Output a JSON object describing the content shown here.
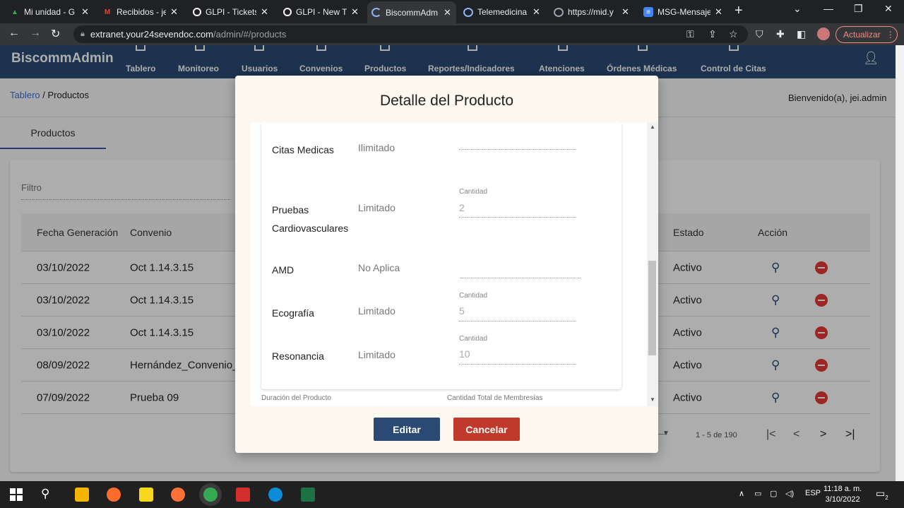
{
  "browser": {
    "tabs": [
      {
        "title": "Mi unidad - G",
        "icon": "drive-icon",
        "color": "#34a853"
      },
      {
        "title": "Recibidos - je",
        "icon": "gmail-icon",
        "color": "#ea4335"
      },
      {
        "title": "GLPI - Tickets",
        "icon": "glpi-icon",
        "color": "#ffffff"
      },
      {
        "title": "GLPI - New Ti",
        "icon": "glpi-icon",
        "color": "#ffffff"
      },
      {
        "title": "BiscommAdm",
        "icon": "loading-icon",
        "color": "#8ab4f8"
      },
      {
        "title": "Telemedicina",
        "icon": "telemed-icon",
        "color": "#8ab4f8"
      },
      {
        "title": "https://mid.y",
        "icon": "globe-icon",
        "color": "#9aa0a6"
      },
      {
        "title": "MSG-Mensaje",
        "icon": "docs-icon",
        "color": "#4285f4"
      }
    ],
    "url_host": "extranet.your24sevendoc.com",
    "url_path": "/admin/#/products",
    "update_label": "Actualizar"
  },
  "app": {
    "brand": "BiscommAdmin",
    "nav": [
      "Tablero",
      "Monitoreo",
      "Usuarios",
      "Convenios",
      "Productos",
      "Reportes/Indicadores",
      "Atenciones",
      "Órdenes Médicas",
      "Control de Citas"
    ],
    "breadcrumb_link": "Tablero",
    "breadcrumb_sep": " / ",
    "breadcrumb_current": "Productos",
    "welcome": "Bienvenido(a), jei.admin",
    "subtab": "Productos",
    "filter_label": "Filtro",
    "columns": {
      "fecha": "Fecha Generación",
      "convenio": "Convenio",
      "estado": "Estado",
      "accion": "Acción"
    },
    "rows": [
      {
        "fecha": "03/10/2022",
        "convenio": "Oct 1.14.3.15",
        "estado": "Activo"
      },
      {
        "fecha": "03/10/2022",
        "convenio": "Oct 1.14.3.15",
        "estado": "Activo"
      },
      {
        "fecha": "03/10/2022",
        "convenio": "Oct 1.14.3.15",
        "estado": "Activo"
      },
      {
        "fecha": "08/09/2022",
        "convenio": "Hernández_Convenio_",
        "estado": "Activo"
      },
      {
        "fecha": "07/09/2022",
        "convenio": "Prueba 09",
        "estado": "Activo"
      }
    ],
    "pager_range": "1 - 5 de 190"
  },
  "modal": {
    "title": "Detalle del Producto",
    "services": [
      {
        "name": "Citas Medicas",
        "status": "Ilimitado",
        "qty_label": "",
        "qty": ""
      },
      {
        "name": "Pruebas Cardiovasculares",
        "status": "Limitado",
        "qty_label": "Cantidad",
        "qty": "2"
      },
      {
        "name": "AMD",
        "status": "No Aplica",
        "qty_label": "",
        "qty": ""
      },
      {
        "name": "Ecografía",
        "status": "Limitado",
        "qty_label": "Cantidad",
        "qty": "5"
      },
      {
        "name": "Resonancia",
        "status": "Limitado",
        "qty_label": "Cantidad",
        "qty": "10"
      }
    ],
    "footer_duration_label": "Duración del Producto",
    "footer_total_label": "Cantidad Total de Membresías",
    "edit_label": "Editar",
    "cancel_label": "Cancelar",
    "edit_color": "#2a4a73",
    "cancel_color": "#c0392b"
  },
  "system": {
    "language": "ESP",
    "time": "11:18 a. m.",
    "date": "3/10/2022",
    "notifications": "2"
  }
}
